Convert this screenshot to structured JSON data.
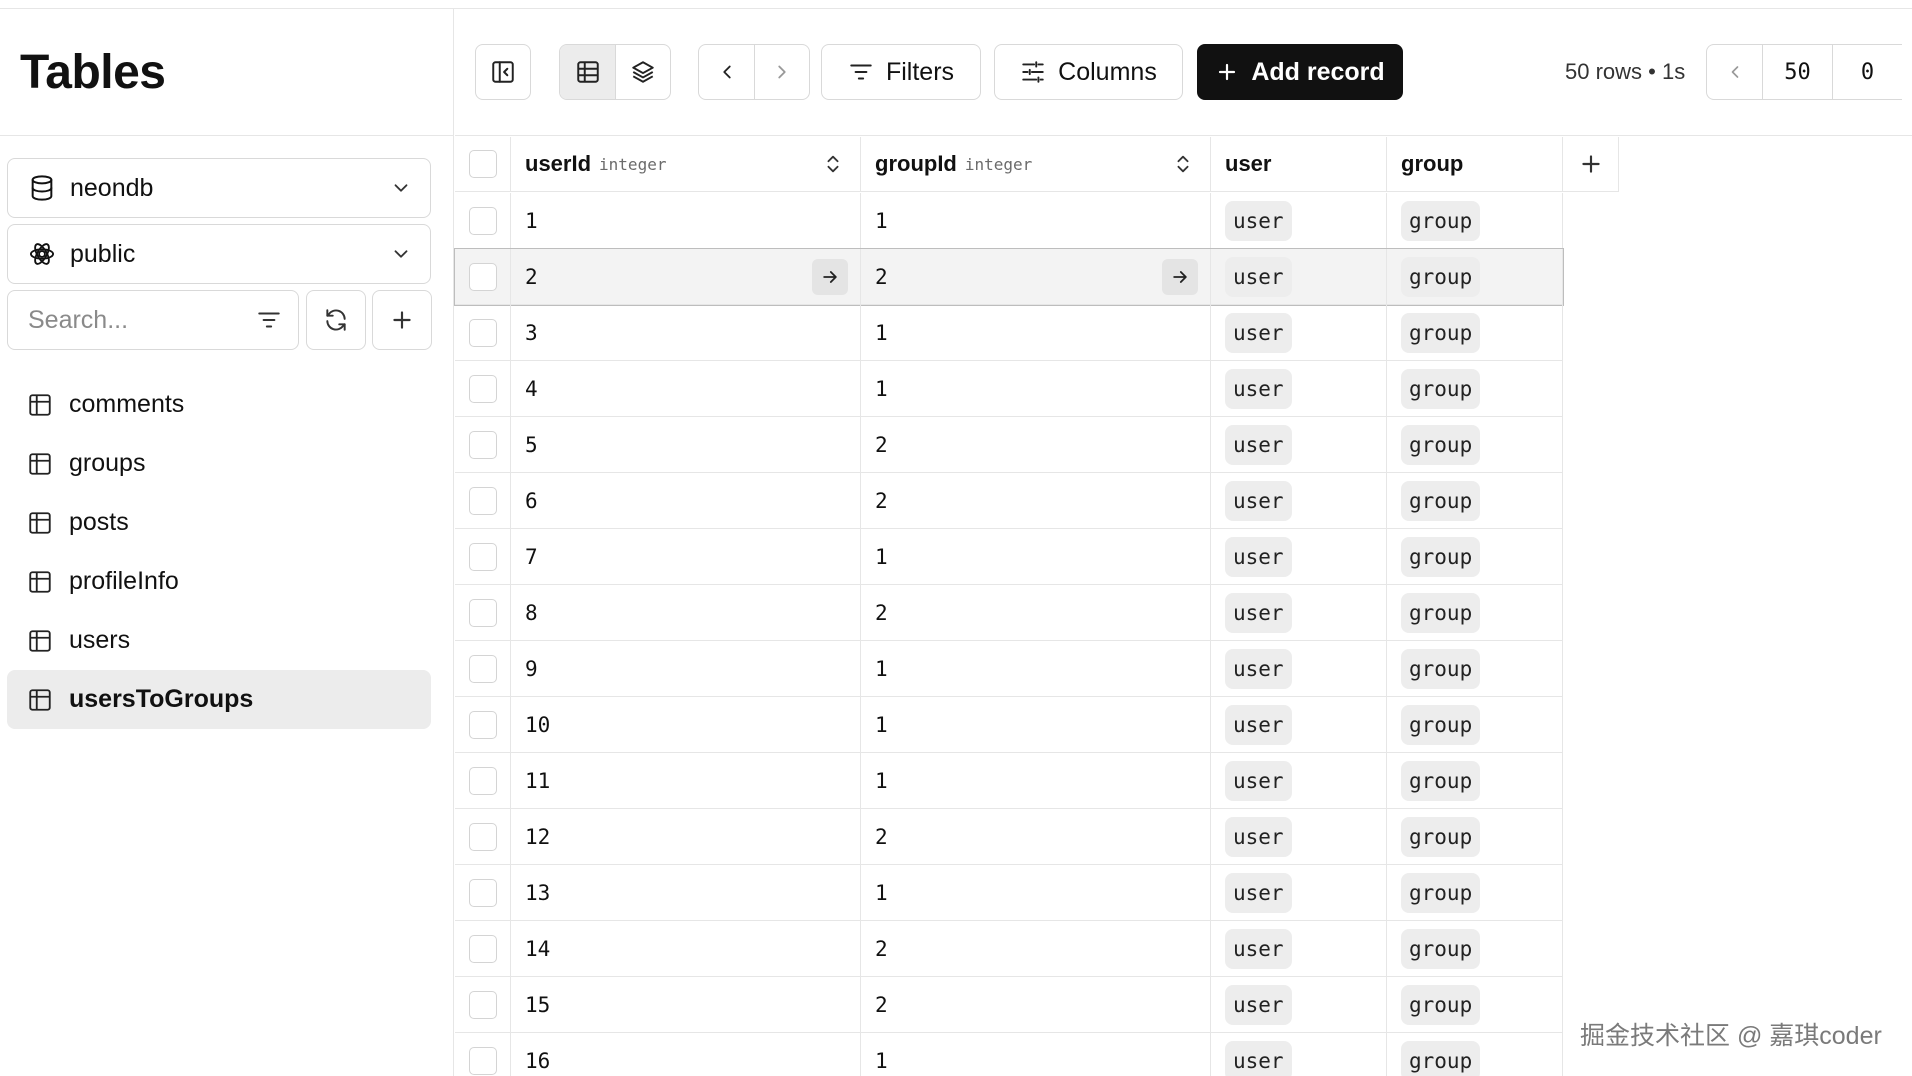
{
  "sidebar": {
    "title": "Tables",
    "database": "neondb",
    "schema": "public",
    "search_placeholder": "Search...",
    "tables": [
      "comments",
      "groups",
      "posts",
      "profileInfo",
      "users",
      "usersToGroups"
    ],
    "active_table": "usersToGroups"
  },
  "toolbar": {
    "filters_label": "Filters",
    "columns_label": "Columns",
    "add_record_label": "Add record",
    "rows_info": "50 rows • 1s",
    "page_size": "50",
    "offset": "0"
  },
  "grid": {
    "columns": [
      {
        "name": "userId",
        "type": "integer",
        "sortable": true
      },
      {
        "name": "groupId",
        "type": "integer",
        "sortable": true
      },
      {
        "name": "user",
        "type": "",
        "sortable": false
      },
      {
        "name": "group",
        "type": "",
        "sortable": false
      }
    ],
    "rows": [
      {
        "userId": "1",
        "groupId": "1",
        "user": "user",
        "group": "group"
      },
      {
        "userId": "2",
        "groupId": "2",
        "user": "user",
        "group": "group",
        "hovered": true
      },
      {
        "userId": "3",
        "groupId": "1",
        "user": "user",
        "group": "group"
      },
      {
        "userId": "4",
        "groupId": "1",
        "user": "user",
        "group": "group"
      },
      {
        "userId": "5",
        "groupId": "2",
        "user": "user",
        "group": "group"
      },
      {
        "userId": "6",
        "groupId": "2",
        "user": "user",
        "group": "group"
      },
      {
        "userId": "7",
        "groupId": "1",
        "user": "user",
        "group": "group"
      },
      {
        "userId": "8",
        "groupId": "2",
        "user": "user",
        "group": "group"
      },
      {
        "userId": "9",
        "groupId": "1",
        "user": "user",
        "group": "group"
      },
      {
        "userId": "10",
        "groupId": "1",
        "user": "user",
        "group": "group"
      },
      {
        "userId": "11",
        "groupId": "1",
        "user": "user",
        "group": "group"
      },
      {
        "userId": "12",
        "groupId": "2",
        "user": "user",
        "group": "group"
      },
      {
        "userId": "13",
        "groupId": "1",
        "user": "user",
        "group": "group"
      },
      {
        "userId": "14",
        "groupId": "2",
        "user": "user",
        "group": "group"
      },
      {
        "userId": "15",
        "groupId": "2",
        "user": "user",
        "group": "group"
      },
      {
        "userId": "16",
        "groupId": "1",
        "user": "user",
        "group": "group"
      }
    ]
  },
  "watermark": "掘金技术社区 @ 嘉琪coder",
  "colors": {
    "primary": "#111111",
    "border": "#d9d9d9",
    "active_bg": "#ececec",
    "chip_bg": "#ededed"
  }
}
